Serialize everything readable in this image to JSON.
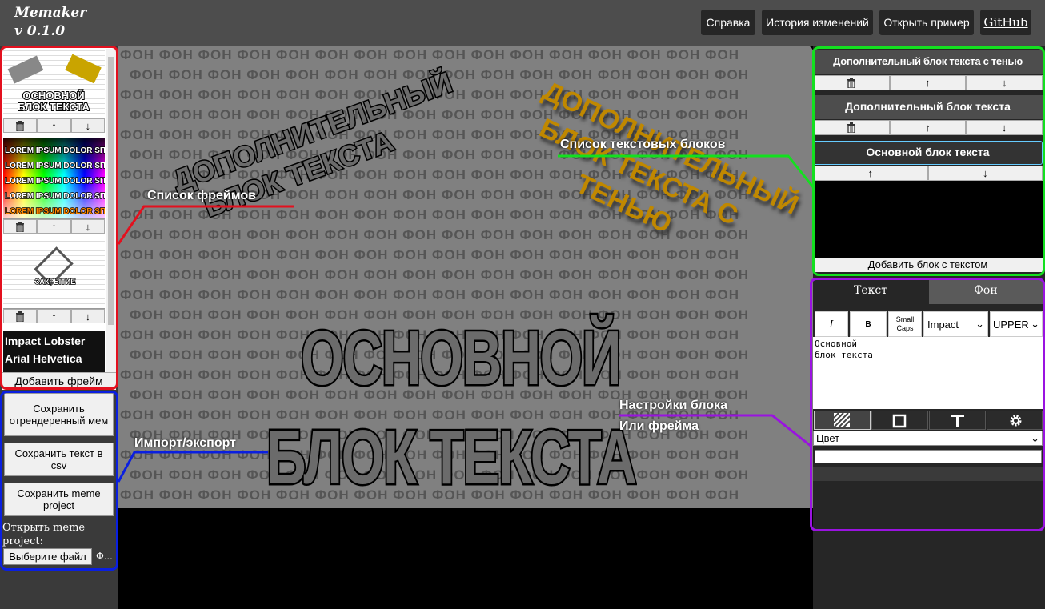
{
  "header": {
    "title_line1": "Memaker",
    "title_line2": "v 0.1.0",
    "nav": [
      "Справка",
      "История изменений",
      "Открыть пример",
      "GitHub"
    ]
  },
  "frames": {
    "items": [
      {
        "caption": "ОСНОВНОЙ БЛОК ТЕКСТА"
      },
      {
        "caption": "LOREM IPSUM DOLOR SIT AMET"
      },
      {
        "caption": "ЗАКРЫТИЕ"
      },
      {
        "caption": "Impact Lobster Arial Helvetica"
      }
    ],
    "delete_icon": "trash-icon",
    "up_icon": "↑",
    "down_icon": "↓",
    "add_label": "Добавить фрейм"
  },
  "io": {
    "save_rendered": "Сохранить отрендеренный мем",
    "save_csv": "Сохранить текст в csv",
    "save_project": "Сохранить meme project",
    "open_project_label": "Открыть meme project:",
    "choose_file": "Выберите файл",
    "file_status": "Ф..."
  },
  "canvas": {
    "bg_word": "ФОН",
    "main_text_line1": "ОСНОВНОЙ",
    "main_text_line2": "БЛОК ТЕКСТА",
    "extra_text": "ДОПОЛНИТЕЛЬНЫЙ БЛОК ТЕКСТА",
    "shadow_text": "ДОПОЛНИТЕЛЬНЫЙ БЛОК ТЕКСТА С ТЕНЬЮ"
  },
  "text_blocks": {
    "items": [
      "Дополнительный блок текста с тенью",
      "Дополнительный блок текста",
      "Основной блок текста"
    ],
    "add_label": "Добавить блок с текстом"
  },
  "settings": {
    "tabs": [
      "Текст",
      "Фон"
    ],
    "italic": "I",
    "bold": "B",
    "smallcaps": "Small Caps",
    "font": "Impact",
    "case": "UPPER",
    "textarea": "Основной\nблок текста",
    "style_tabs": [
      "fill-icon",
      "stroke-icon",
      "text-icon",
      "gear-icon"
    ],
    "color_select": "Цвет"
  },
  "annotations": {
    "frames": "Список фреймов",
    "io": "Импорт/экспорт",
    "text_blocks": "Список текстовых блоков",
    "settings_line1": "Настройки блока",
    "settings_line2": "Или фрейма"
  },
  "colors": {
    "frames_box": "#e3101e",
    "io_box": "#0a1fe0",
    "text_blocks_box": "#13e01f",
    "settings_box": "#9a13e0"
  }
}
